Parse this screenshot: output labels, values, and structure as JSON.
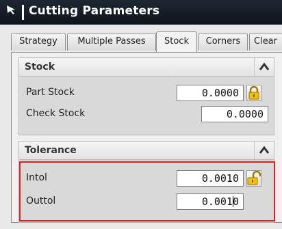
{
  "window": {
    "title": "Cutting Parameters"
  },
  "tabs": [
    {
      "label": "Strategy",
      "active": false
    },
    {
      "label": "Multiple Passes",
      "active": false
    },
    {
      "label": "Stock",
      "active": true
    },
    {
      "label": "Corners",
      "active": false
    },
    {
      "label": "Clear",
      "active": false
    }
  ],
  "stock_group": {
    "header": "Stock",
    "part_stock": {
      "label": "Part Stock",
      "value": "0.0000",
      "lock_icon": "locked-padlock-icon"
    },
    "check_stock": {
      "label": "Check Stock",
      "value": "0.0000"
    }
  },
  "tolerance_group": {
    "header": "Tolerance",
    "intol": {
      "label": "Intol",
      "value": "0.0010",
      "lock_icon": "unlocked-padlock-icon"
    },
    "outtol": {
      "label": "Outtol",
      "value": "0.0010"
    }
  },
  "colors": {
    "title_bar": "#0e141b",
    "highlight_border": "#e02020",
    "lock_yellow": "#f2c200"
  }
}
